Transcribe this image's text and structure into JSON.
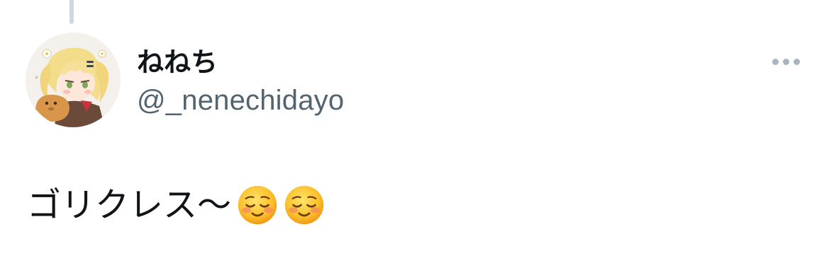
{
  "tweet": {
    "author": {
      "display_name": "ねねち",
      "handle": "@_nenechidayo",
      "avatar": "avatar-illustration"
    },
    "text": "ゴリクレス〜",
    "emojis": [
      "smiling-face-icon",
      "smiling-face-icon"
    ],
    "more_icon": "more-icon"
  },
  "colors": {
    "name": "#0f1419",
    "handle": "#536471",
    "thread_line": "#cfd9de",
    "more_dots": "#a8b5bf"
  }
}
